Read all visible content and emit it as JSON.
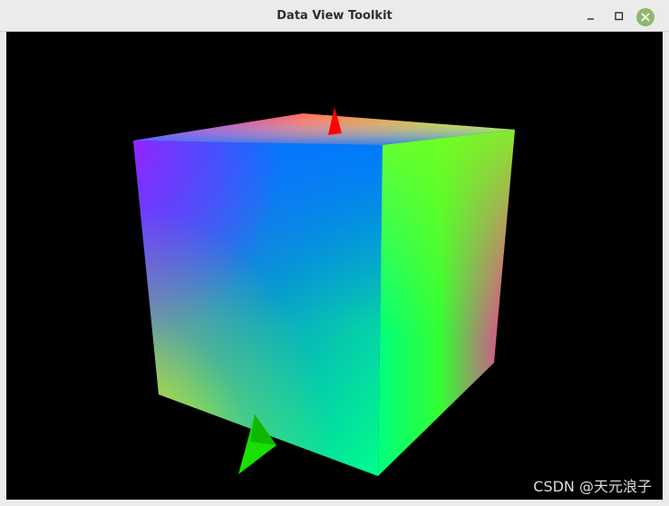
{
  "window": {
    "title": "Data View Toolkit"
  },
  "controls": {
    "minimize_icon": "minimize-icon",
    "maximize_icon": "maximize-icon",
    "close_icon": "close-icon",
    "close_color": "#8fb86e"
  },
  "viewport": {
    "background": "#000000",
    "object": "rgb-color-cube",
    "watermark": "CSDN @天元浪子"
  }
}
